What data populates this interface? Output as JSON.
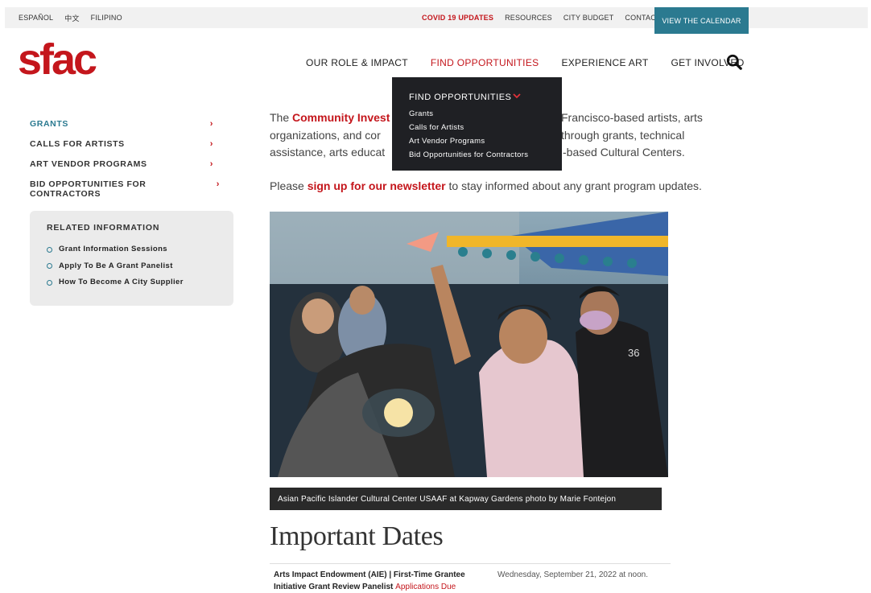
{
  "topbar": {
    "languages": [
      "ESPAÑOL",
      "中文",
      "FILIPINO"
    ],
    "links": [
      "COVID 19 UPDATES",
      "RESOURCES",
      "CITY BUDGET",
      "CONTACT"
    ],
    "calendar_label": "VIEW THE CALENDAR",
    "accent": "#c4161c",
    "teal": "#2b7a90"
  },
  "logo": {
    "text": "sfac"
  },
  "nav": {
    "items": [
      "OUR ROLE & IMPACT",
      "FIND OPPORTUNITIES",
      "EXPERIENCE ART",
      "GET INVOLVED"
    ]
  },
  "dropdown": {
    "title": "FIND OPPORTUNITIES",
    "items": [
      "Grants",
      "Calls for Artists",
      "Art Vendor Programs",
      "Bid Opportunities for Contractors"
    ]
  },
  "sidebar": {
    "items": [
      {
        "label": "GRANTS",
        "chev": "›"
      },
      {
        "label": "CALLS FOR ARTISTS",
        "chev": "›"
      },
      {
        "label": "ART VENDOR PROGRAMS",
        "chev": "›"
      },
      {
        "label": "BID OPPORTUNITIES FOR CONTRACTORS",
        "chev": "›"
      }
    ],
    "related_title": "RELATED INFORMATION",
    "related_links": [
      "Grant Information Sessions",
      "Apply To Be A Grant Panelist",
      "How To Become A City Supplier"
    ]
  },
  "main": {
    "intro_pre": "The ",
    "intro_link": "Community Invest",
    "intro_mid": " ",
    "intro_right1": "Francisco-based artists, arts",
    "intro_line2a": "organizations, and cor",
    "intro_line2b": "through grants, technical",
    "intro_line3a": "assistance, arts educat",
    "intro_line3b": "-based Cultural Centers.",
    "newsletter_pre": "Please ",
    "newsletter_link": "sign up for our newsletter",
    "newsletter_post": " to stay informed about any grant program updates.",
    "caption": "Asian Pacific Islander Cultural Center USAAF at Kapway Gardens photo by Marie Fontejon",
    "dates_title": "Important Dates",
    "date_event": "Arts Impact Endowment (AIE) | First-Time Grantee Initiative Grant Review Panelist",
    "date_event_link": "Applications Due",
    "date_when": "Wednesday, September 21, 2022 at noon."
  }
}
